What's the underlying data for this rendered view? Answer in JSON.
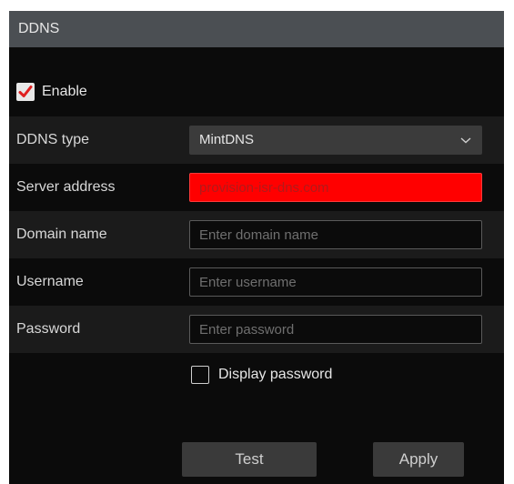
{
  "window": {
    "title": "DDNS"
  },
  "enable": {
    "label": "Enable",
    "checked": true
  },
  "fields": {
    "ddns_type": {
      "label": "DDNS type",
      "value": "MintDNS"
    },
    "server_address": {
      "label": "Server address",
      "value": "provision-isr-dns.com"
    },
    "domain_name": {
      "label": "Domain name",
      "value": "",
      "placeholder": "Enter domain name"
    },
    "username": {
      "label": "Username",
      "value": "",
      "placeholder": "Enter username"
    },
    "password": {
      "label": "Password",
      "value": "",
      "placeholder": "Enter password"
    }
  },
  "display_password": {
    "label": "Display password",
    "checked": false
  },
  "buttons": {
    "test": "Test",
    "apply": "Apply"
  },
  "colors": {
    "background": "#0b0b0b",
    "titlebar": "#4b4f53",
    "checkmark": "#e02020",
    "server_highlight": "#ff0000"
  },
  "icons": {
    "dropdown": "chevron-down-icon",
    "check": "checkmark-icon"
  }
}
